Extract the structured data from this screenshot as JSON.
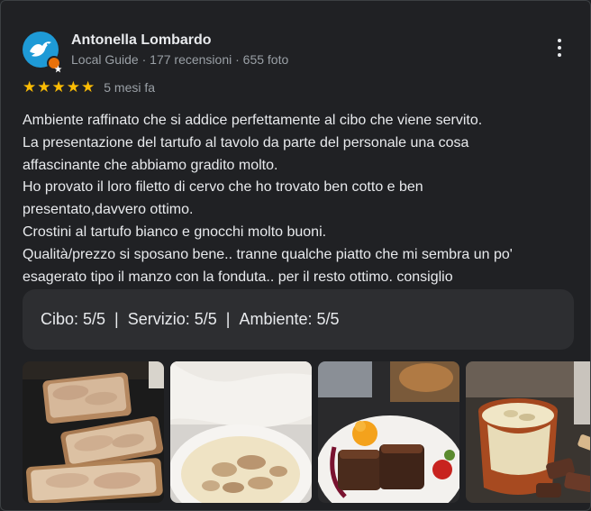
{
  "reviewer": {
    "name": "Antonella Lombardo",
    "meta": "Local Guide · 177 recensioni · 655 foto",
    "avatar_icon": "bird-icon",
    "badge_icon": "local-guide-star-icon"
  },
  "rating": {
    "stars": 5,
    "star_symbol": "★",
    "time": "5 mesi fa"
  },
  "review_lines": [
    "Ambiente raffinato che si addice perfettamente al cibo che viene servito.",
    "La presentazione del tartufo al tavolo da parte del personale una cosa",
    "affascinante che abbiamo gradito molto.",
    "Ho provato il loro filetto di cervo che ho trovato ben cotto e ben",
    "presentato,davvero ottimo.",
    "Crostini al tartufo bianco e gnocchi molto buoni.",
    "Qualità/prezzo si sposano bene.. tranne qualche piatto che mi sembra un po'",
    "esagerato tipo il manzo con la fonduta.. per il resto ottimo. consiglio"
  ],
  "scores": {
    "cibo": "Cibo: 5/5",
    "servizio": "Servizio: 5/5",
    "ambiente": "Ambiente: 5/5",
    "separator": "|"
  },
  "colors": {
    "background": "#202124",
    "star": "#fbbc04",
    "secondary_text": "#9aa0a6",
    "score_panel": "#2d2e31",
    "avatar": "#1e9ad6",
    "badge": "#e8710a"
  }
}
